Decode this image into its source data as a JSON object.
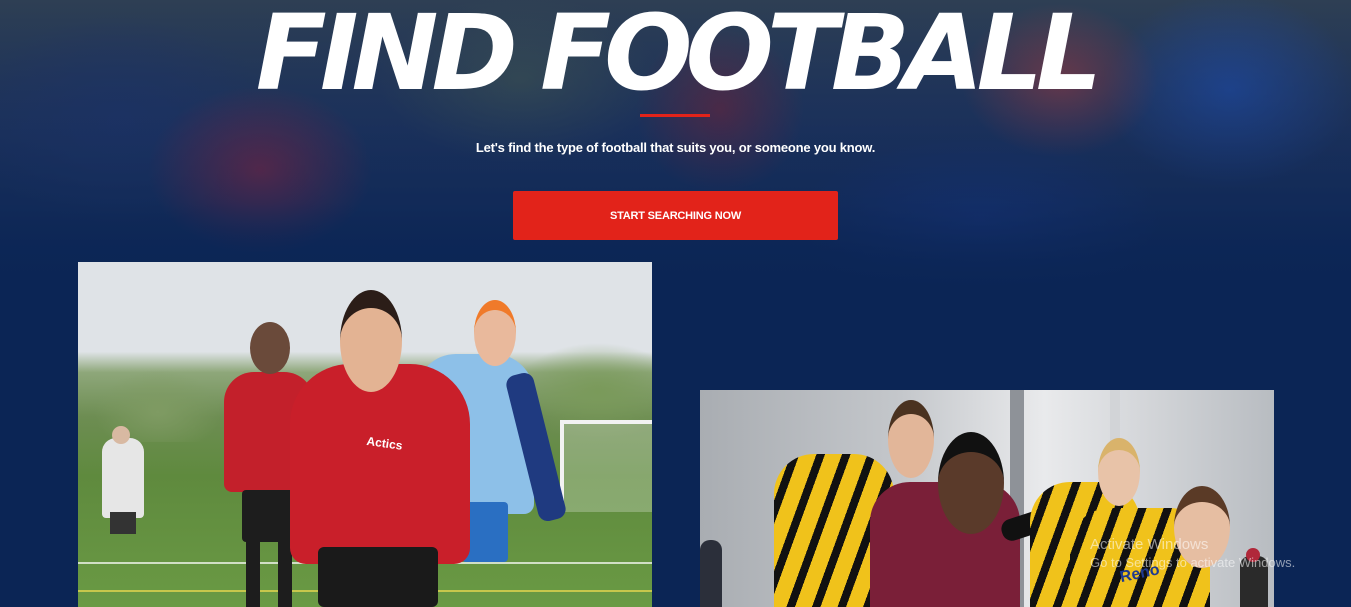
{
  "hero": {
    "title": "FIND FOOTBALL",
    "subtitle": "Let's find the type of football that suits you, or someone you know.",
    "cta_label": "START SEARCHING NOW"
  },
  "colors": {
    "background": "#0b2555",
    "accent": "#e2231a",
    "text": "#ffffff"
  },
  "photos": {
    "left": {
      "shirt_text": "Actics"
    },
    "right": {
      "shirt_text": "Reno"
    }
  },
  "watermark": {
    "line1": "Activate Windows",
    "line2": "Go to Settings to activate Windows."
  }
}
